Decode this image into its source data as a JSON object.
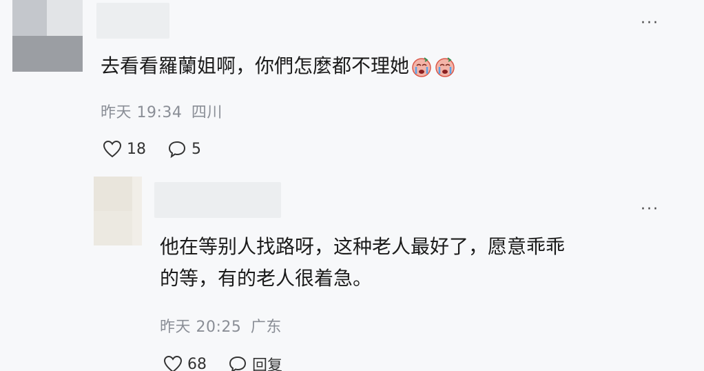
{
  "comments": [
    {
      "text": "去看看羅蘭姐啊，你們怎麼都不理她",
      "emoji_count": 2,
      "emoji_icon": "crying-face-icon",
      "time": "昨天 19:34",
      "location": "四川",
      "likes": "18",
      "replies": "5",
      "more_label": "···"
    },
    {
      "text_line1": "他在等别人找路呀，这种老人最好了，愿意乖乖",
      "text_line2": "的等，有的老人很着急。",
      "time": "昨天 20:25",
      "location": "广东",
      "likes": "68",
      "reply_label": "回复",
      "more_label": "···"
    }
  ],
  "colors": {
    "background": "#f7f8fa",
    "meta_text": "#8a8e96",
    "body_text": "#1b1b1b"
  }
}
